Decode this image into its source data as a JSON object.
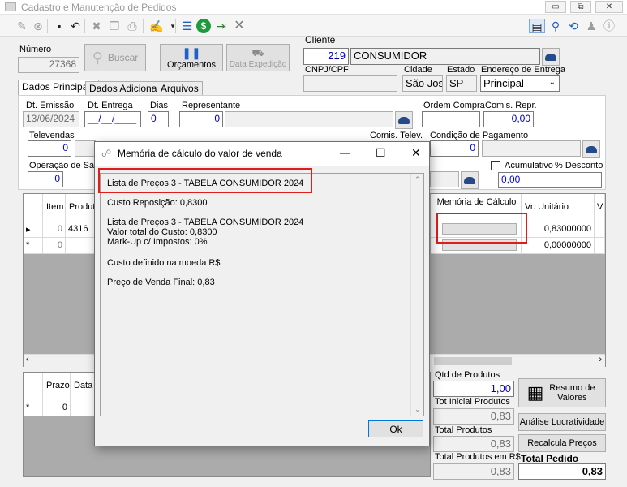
{
  "window": {
    "title": "Cadastro e Manutenção de Pedidos",
    "minimize": "▭",
    "restore": "⧉",
    "close": "✕"
  },
  "toolbar": {
    "icons": [
      "new-icon",
      "cancel-icon",
      "save-icon",
      "undo-icon",
      "delete-icon",
      "copy-icon",
      "print-icon",
      "edit-icon",
      "list-icon",
      "money-icon",
      "push-icon",
      "close-x-icon"
    ],
    "right_icons": [
      "window-icon",
      "key-icon",
      "refresh-icon",
      "user-icon",
      "info-icon"
    ]
  },
  "header": {
    "numero_label": "Número",
    "numero_value": "27368",
    "buscar_label": "Buscar",
    "orcamentos_label": "Orçamentos",
    "data_expedicao_label": "Data Expedição",
    "cliente_label": "Cliente",
    "cliente_code": "219",
    "cliente_name": "CONSUMIDOR",
    "cnpj_label": "CNPJ/CPF",
    "cnpj_value": "",
    "cidade_label": "Cidade",
    "cidade_value": "São Jos",
    "estado_label": "Estado",
    "estado_value": "SP",
    "endereco_label": "Endereço de Entrega",
    "endereco_value": "Principal"
  },
  "tabs": [
    {
      "label": "Dados Principais"
    },
    {
      "label": "Dados Adicionais"
    },
    {
      "label": "Arquivos"
    }
  ],
  "main": {
    "dt_emissao_label": "Dt. Emissão",
    "dt_emissao_value": "13/06/2024",
    "dt_entrega_label": "Dt. Entrega",
    "dt_entrega_value": "__/__/____",
    "dias_label": "Dias",
    "dias_value": "0",
    "representante_label": "Representante",
    "representante_value": "0",
    "ordem_compra_label": "Ordem Compra",
    "comis_repr_label": "Comis. Repr.",
    "comis_repr_value": "0,00",
    "televendas_label": "Televendas",
    "televendas_value": "0",
    "comis_telev_label": "Comis. Telev.",
    "condicao_label": "Condição de Pagamento",
    "condicao_value": "0",
    "operacao_label": "Operação de Saí",
    "operacao_value": "0",
    "acumulativo_label": "Acumulativo",
    "desconto_label": "% Desconto",
    "desconto_value": "0,00"
  },
  "grid": {
    "headers": {
      "item": "Item",
      "produto": "Produt",
      "memoria": "Memória de Cálculo",
      "vr_unitario": "Vr. Unitário",
      "extra": "V"
    },
    "rows": [
      {
        "marker": "▸",
        "item": "0",
        "produto": "4316",
        "vr_unitario": "0,83000000"
      },
      {
        "marker": "*",
        "item": "0",
        "produto": "",
        "vr_unitario": "0,00000000"
      }
    ]
  },
  "grid2": {
    "headers": {
      "prazo": "Prazo",
      "data": "Data"
    },
    "rows": [
      {
        "marker": "*",
        "prazo": "0"
      }
    ]
  },
  "totals": {
    "qtd_label": "Qtd de Produtos",
    "qtd_value": "1,00",
    "tot_inicial_label": "Tot Inicial Produtos",
    "tot_inicial_value": "0,83",
    "total_produtos_label": "Total Produtos",
    "total_produtos_value": "0,83",
    "total_rs_label": "Total Produtos em R$",
    "total_rs_value": "0,83",
    "total_pedido_label": "Total Pedido",
    "total_pedido_value": "0,83",
    "resumo_label": "Resumo de Valores",
    "analise_label": "Análise Lucratividade",
    "recalcula_label": "Recalcula Preços"
  },
  "dialog": {
    "title": "Memória de cálculo do valor de venda",
    "lines": [
      "Lista de Preços 3 - TABELA CONSUMIDOR 2024",
      "Custo Reposição: 0,8300",
      "Lista de Preços 3 - TABELA CONSUMIDOR 2024",
      "Valor total do Custo: 0,8300",
      "Mark-Up c/ Impostos: 0%",
      "Custo definido na moeda R$",
      "Preço de Venda Final: 0,83"
    ],
    "ok_label": "Ok",
    "minimize": "—",
    "maximize": "☐",
    "close": "✕"
  }
}
